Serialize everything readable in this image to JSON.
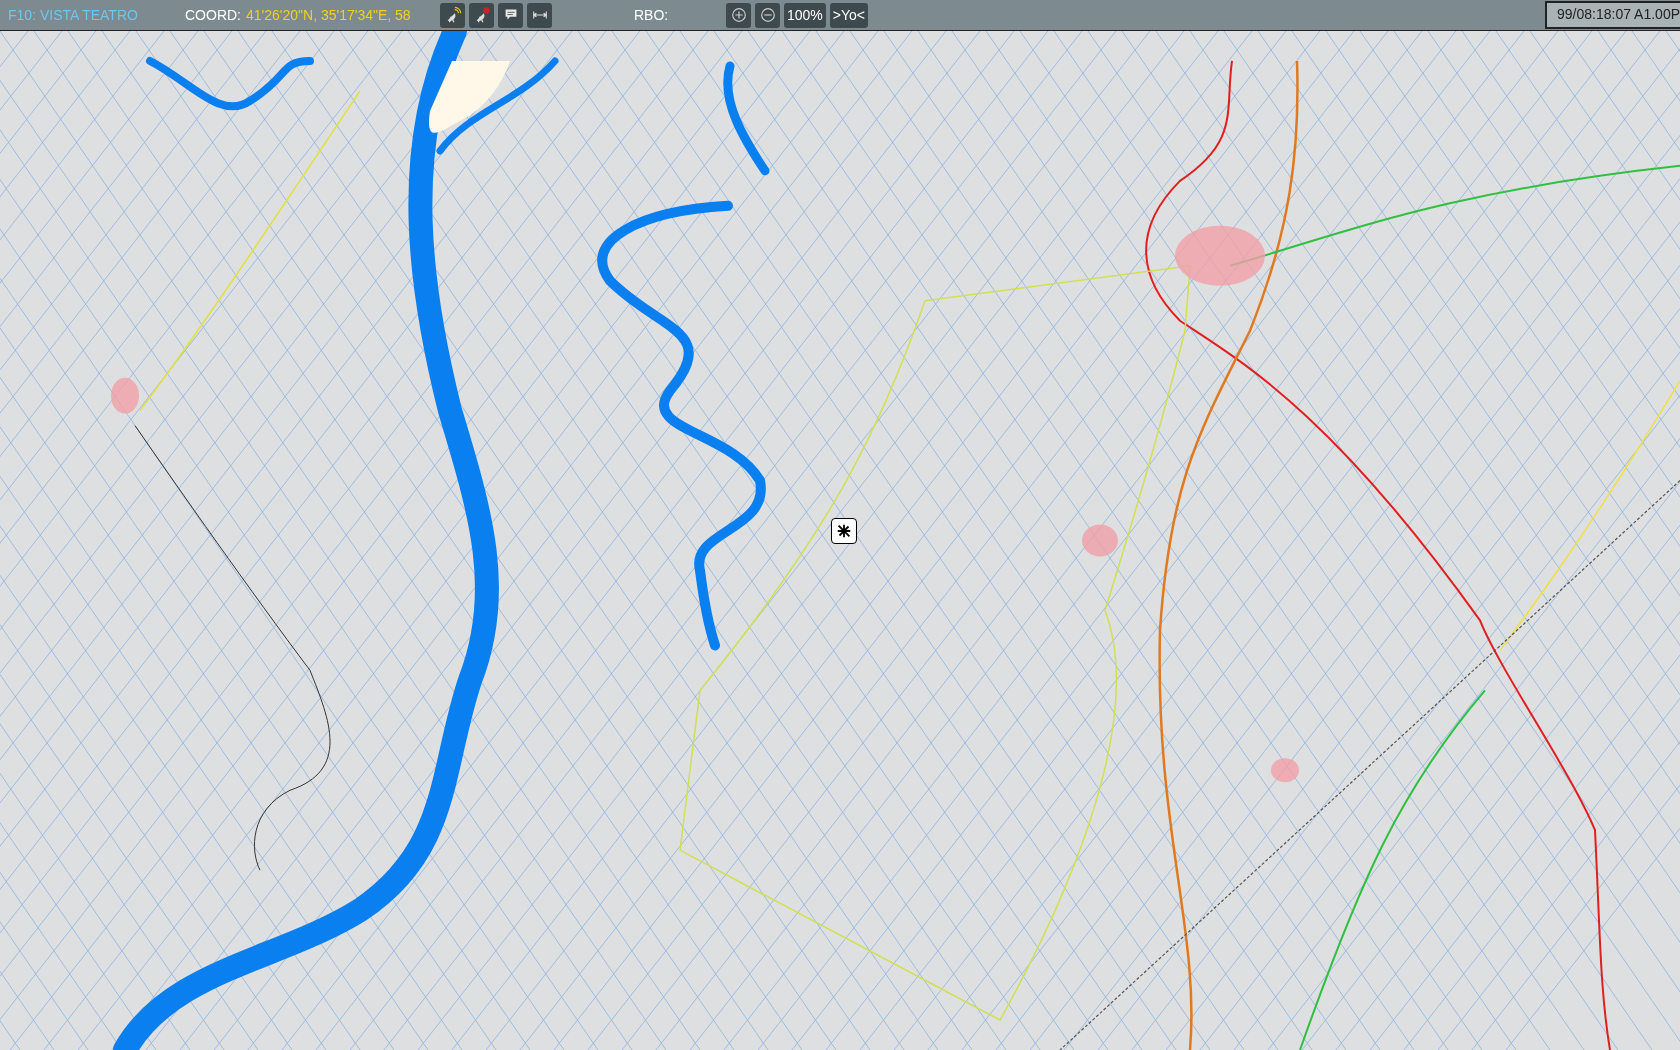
{
  "toolbar": {
    "title": "F10: VISTA TEATRO",
    "coord_label": "COORD:",
    "coord_value": "41'26'20\"N, 35'17'34\"E, 58",
    "tools": [
      {
        "kind": "dish-signal"
      },
      {
        "kind": "dish-alert"
      },
      {
        "kind": "comment"
      },
      {
        "kind": "measure"
      }
    ],
    "rbo_label": "RBO:",
    "zoom_controls": [
      {
        "kind": "zoom-in"
      },
      {
        "kind": "zoom-out"
      },
      {
        "kind": "text",
        "label": "100%"
      },
      {
        "kind": "text",
        "label": ">Yo<"
      }
    ],
    "clock": "99/08:18:07 A1.00P"
  },
  "map": {
    "marker": {
      "kind": "target"
    }
  }
}
